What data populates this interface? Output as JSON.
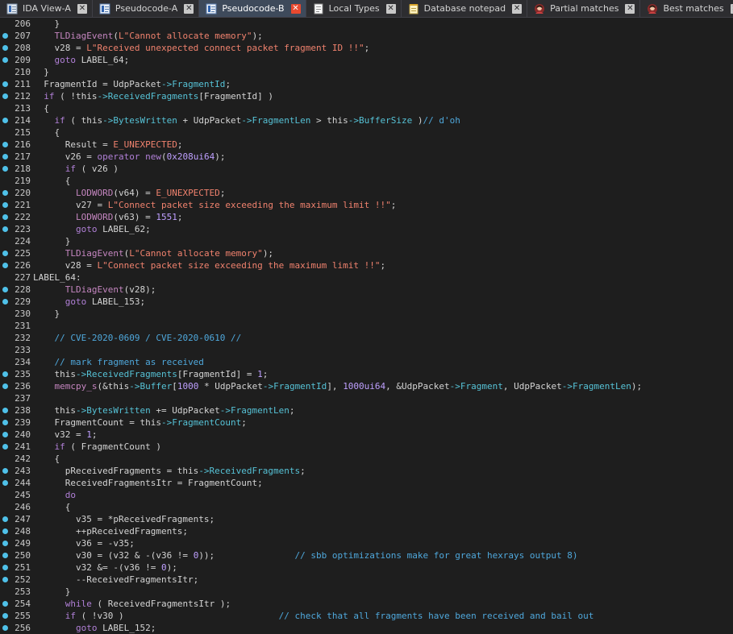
{
  "tabs": [
    {
      "label": "IDA View-A",
      "icon": "ida-view-icon",
      "active": false
    },
    {
      "label": "Pseudocode-A",
      "icon": "pseudocode-icon",
      "active": false
    },
    {
      "label": "Pseudocode-B",
      "icon": "pseudocode-icon",
      "active": true
    },
    {
      "label": "Local Types",
      "icon": "local-types-icon",
      "active": false
    },
    {
      "label": "Database notepad",
      "icon": "notepad-icon",
      "active": false
    },
    {
      "label": "Partial matches",
      "icon": "avatar-icon",
      "active": false
    },
    {
      "label": "Best matches",
      "icon": "avatar-icon",
      "active": false
    }
  ],
  "close_glyph": "✕",
  "colors": {
    "background": "#1e1e1e",
    "keyword": "#b180d7",
    "string": "#f0826e",
    "comment": "#4fa8dc",
    "member": "#56c2d6",
    "breakpoint": "#4fc1e9",
    "active_tab_close": "#e8492f"
  },
  "lines": [
    {
      "n": "206",
      "bp": false,
      "t": [
        [
          "p",
          "    }"
        ]
      ]
    },
    {
      "n": "207",
      "bp": true,
      "t": [
        [
          "p",
          "    "
        ],
        [
          "f",
          "TLDiagEvent"
        ],
        [
          "p",
          "("
        ],
        [
          "s",
          "L\"Cannot allocate memory\""
        ],
        [
          "p",
          ");"
        ]
      ]
    },
    {
      "n": "208",
      "bp": true,
      "t": [
        [
          "p",
          "    v28 = "
        ],
        [
          "s",
          "L\"Received unexpected connect packet fragment ID !!\""
        ],
        [
          "p",
          ";"
        ]
      ]
    },
    {
      "n": "209",
      "bp": true,
      "t": [
        [
          "p",
          "    "
        ],
        [
          "k",
          "goto"
        ],
        [
          "p",
          " LABEL_64;"
        ]
      ]
    },
    {
      "n": "210",
      "bp": false,
      "t": [
        [
          "p",
          "  }"
        ]
      ]
    },
    {
      "n": "211",
      "bp": true,
      "t": [
        [
          "p",
          "  FragmentId = UdpPacket"
        ],
        [
          "m",
          "->FragmentId"
        ],
        [
          "p",
          ";"
        ]
      ]
    },
    {
      "n": "212",
      "bp": true,
      "t": [
        [
          "p",
          "  "
        ],
        [
          "k",
          "if"
        ],
        [
          "p",
          " ( !this"
        ],
        [
          "m",
          "->ReceivedFragments"
        ],
        [
          "p",
          "[FragmentId] )"
        ]
      ]
    },
    {
      "n": "213",
      "bp": false,
      "t": [
        [
          "p",
          "  {"
        ]
      ]
    },
    {
      "n": "214",
      "bp": true,
      "t": [
        [
          "p",
          "    "
        ],
        [
          "k",
          "if"
        ],
        [
          "p",
          " ( this"
        ],
        [
          "m",
          "->BytesWritten"
        ],
        [
          "p",
          " + UdpPacket"
        ],
        [
          "m",
          "->FragmentLen"
        ],
        [
          "p",
          " > this"
        ],
        [
          "m",
          "->BufferSize"
        ],
        [
          "p",
          " )"
        ],
        [
          "c",
          "// d'oh"
        ]
      ]
    },
    {
      "n": "215",
      "bp": false,
      "t": [
        [
          "p",
          "    {"
        ]
      ]
    },
    {
      "n": "216",
      "bp": true,
      "t": [
        [
          "p",
          "      Result = "
        ],
        [
          "s",
          "E_UNEXPECTED"
        ],
        [
          "p",
          ";"
        ]
      ]
    },
    {
      "n": "217",
      "bp": true,
      "t": [
        [
          "p",
          "      v26 = "
        ],
        [
          "k",
          "operator new"
        ],
        [
          "p",
          "("
        ],
        [
          "n",
          "0x208ui64"
        ],
        [
          "p",
          ");"
        ]
      ]
    },
    {
      "n": "218",
      "bp": true,
      "t": [
        [
          "p",
          "      "
        ],
        [
          "k",
          "if"
        ],
        [
          "p",
          " ( v26 )"
        ]
      ]
    },
    {
      "n": "219",
      "bp": false,
      "t": [
        [
          "p",
          "      {"
        ]
      ]
    },
    {
      "n": "220",
      "bp": true,
      "t": [
        [
          "p",
          "        "
        ],
        [
          "f",
          "LODWORD"
        ],
        [
          "p",
          "(v64) = "
        ],
        [
          "s",
          "E_UNEXPECTED"
        ],
        [
          "p",
          ";"
        ]
      ]
    },
    {
      "n": "221",
      "bp": true,
      "t": [
        [
          "p",
          "        v27 = "
        ],
        [
          "s",
          "L\"Connect packet size exceeding the maximum limit !!\""
        ],
        [
          "p",
          ";"
        ]
      ]
    },
    {
      "n": "222",
      "bp": true,
      "t": [
        [
          "p",
          "        "
        ],
        [
          "f",
          "LODWORD"
        ],
        [
          "p",
          "(v63) = "
        ],
        [
          "n",
          "1551"
        ],
        [
          "p",
          ";"
        ]
      ]
    },
    {
      "n": "223",
      "bp": true,
      "t": [
        [
          "p",
          "        "
        ],
        [
          "k",
          "goto"
        ],
        [
          "p",
          " LABEL_62;"
        ]
      ]
    },
    {
      "n": "224",
      "bp": false,
      "t": [
        [
          "p",
          "      }"
        ]
      ]
    },
    {
      "n": "225",
      "bp": true,
      "t": [
        [
          "p",
          "      "
        ],
        [
          "f",
          "TLDiagEvent"
        ],
        [
          "p",
          "("
        ],
        [
          "s",
          "L\"Cannot allocate memory\""
        ],
        [
          "p",
          ");"
        ]
      ]
    },
    {
      "n": "226",
      "bp": true,
      "t": [
        [
          "p",
          "      v28 = "
        ],
        [
          "s",
          "L\"Connect packet size exceeding the maximum limit !!\""
        ],
        [
          "p",
          ";"
        ]
      ]
    },
    {
      "n": "227",
      "bp": false,
      "label": true,
      "t": [
        [
          "l",
          "LABEL_64:"
        ]
      ]
    },
    {
      "n": "228",
      "bp": true,
      "t": [
        [
          "p",
          "      "
        ],
        [
          "f",
          "TLDiagEvent"
        ],
        [
          "p",
          "(v28);"
        ]
      ]
    },
    {
      "n": "229",
      "bp": true,
      "t": [
        [
          "p",
          "      "
        ],
        [
          "k",
          "goto"
        ],
        [
          "p",
          " LABEL_153;"
        ]
      ]
    },
    {
      "n": "230",
      "bp": false,
      "t": [
        [
          "p",
          "    }"
        ]
      ]
    },
    {
      "n": "231",
      "bp": false,
      "t": [
        [
          "p",
          ""
        ]
      ]
    },
    {
      "n": "232",
      "bp": false,
      "t": [
        [
          "p",
          "    "
        ],
        [
          "c",
          "// CVE-2020-0609 / CVE-2020-0610 //"
        ]
      ]
    },
    {
      "n": "233",
      "bp": false,
      "t": [
        [
          "p",
          ""
        ]
      ]
    },
    {
      "n": "234",
      "bp": false,
      "t": [
        [
          "p",
          "    "
        ],
        [
          "c",
          "// mark fragment as received"
        ]
      ]
    },
    {
      "n": "235",
      "bp": true,
      "t": [
        [
          "p",
          "    this"
        ],
        [
          "m",
          "->ReceivedFragments"
        ],
        [
          "p",
          "[FragmentId] = "
        ],
        [
          "n",
          "1"
        ],
        [
          "p",
          ";"
        ]
      ]
    },
    {
      "n": "236",
      "bp": true,
      "t": [
        [
          "p",
          "    "
        ],
        [
          "f",
          "memcpy_s"
        ],
        [
          "p",
          "(&this"
        ],
        [
          "m",
          "->Buffer"
        ],
        [
          "p",
          "["
        ],
        [
          "n",
          "1000"
        ],
        [
          "p",
          " * UdpPacket"
        ],
        [
          "m",
          "->FragmentId"
        ],
        [
          "p",
          "], "
        ],
        [
          "n",
          "1000ui64"
        ],
        [
          "p",
          ", &UdpPacket"
        ],
        [
          "m",
          "->Fragment"
        ],
        [
          "p",
          ", UdpPacket"
        ],
        [
          "m",
          "->FragmentLen"
        ],
        [
          "p",
          ");"
        ]
      ]
    },
    {
      "n": "237",
      "bp": false,
      "t": [
        [
          "p",
          ""
        ]
      ]
    },
    {
      "n": "238",
      "bp": true,
      "t": [
        [
          "p",
          "    this"
        ],
        [
          "m",
          "->BytesWritten"
        ],
        [
          "p",
          " += UdpPacket"
        ],
        [
          "m",
          "->FragmentLen"
        ],
        [
          "p",
          ";"
        ]
      ]
    },
    {
      "n": "239",
      "bp": true,
      "t": [
        [
          "p",
          "    FragmentCount = this"
        ],
        [
          "m",
          "->FragmentCount"
        ],
        [
          "p",
          ";"
        ]
      ]
    },
    {
      "n": "240",
      "bp": true,
      "t": [
        [
          "p",
          "    v32 = "
        ],
        [
          "n",
          "1"
        ],
        [
          "p",
          ";"
        ]
      ]
    },
    {
      "n": "241",
      "bp": true,
      "t": [
        [
          "p",
          "    "
        ],
        [
          "k",
          "if"
        ],
        [
          "p",
          " ( FragmentCount )"
        ]
      ]
    },
    {
      "n": "242",
      "bp": false,
      "t": [
        [
          "p",
          "    {"
        ]
      ]
    },
    {
      "n": "243",
      "bp": true,
      "t": [
        [
          "p",
          "      pReceivedFragments = this"
        ],
        [
          "m",
          "->ReceivedFragments"
        ],
        [
          "p",
          ";"
        ]
      ]
    },
    {
      "n": "244",
      "bp": true,
      "t": [
        [
          "p",
          "      ReceivedFragmentsItr = FragmentCount;"
        ]
      ]
    },
    {
      "n": "245",
      "bp": false,
      "t": [
        [
          "p",
          "      "
        ],
        [
          "k",
          "do"
        ]
      ]
    },
    {
      "n": "246",
      "bp": false,
      "t": [
        [
          "p",
          "      {"
        ]
      ]
    },
    {
      "n": "247",
      "bp": true,
      "t": [
        [
          "p",
          "        v35 = *pReceivedFragments;"
        ]
      ]
    },
    {
      "n": "248",
      "bp": true,
      "t": [
        [
          "p",
          "        ++pReceivedFragments;"
        ]
      ]
    },
    {
      "n": "249",
      "bp": true,
      "t": [
        [
          "p",
          "        v36 = -v35;"
        ]
      ]
    },
    {
      "n": "250",
      "bp": true,
      "t": [
        [
          "p",
          "        v30 = (v32 & -(v36 != "
        ],
        [
          "n",
          "0"
        ],
        [
          "p",
          "));               "
        ],
        [
          "c",
          "// sbb optimizations make for great hexrays output 8)"
        ]
      ]
    },
    {
      "n": "251",
      "bp": true,
      "t": [
        [
          "p",
          "        v32 &= -(v36 != "
        ],
        [
          "n",
          "0"
        ],
        [
          "p",
          ");"
        ]
      ]
    },
    {
      "n": "252",
      "bp": true,
      "t": [
        [
          "p",
          "        --ReceivedFragmentsItr;"
        ]
      ]
    },
    {
      "n": "253",
      "bp": false,
      "t": [
        [
          "p",
          "      }"
        ]
      ]
    },
    {
      "n": "254",
      "bp": true,
      "t": [
        [
          "p",
          "      "
        ],
        [
          "k",
          "while"
        ],
        [
          "p",
          " ( ReceivedFragmentsItr );"
        ]
      ]
    },
    {
      "n": "255",
      "bp": true,
      "t": [
        [
          "p",
          "      "
        ],
        [
          "k",
          "if"
        ],
        [
          "p",
          " ( !v30 )                             "
        ],
        [
          "c",
          "// check that all fragments have been received and bail out"
        ]
      ]
    },
    {
      "n": "256",
      "bp": true,
      "t": [
        [
          "p",
          "        "
        ],
        [
          "k",
          "goto"
        ],
        [
          "p",
          " LABEL_152;"
        ]
      ]
    }
  ]
}
